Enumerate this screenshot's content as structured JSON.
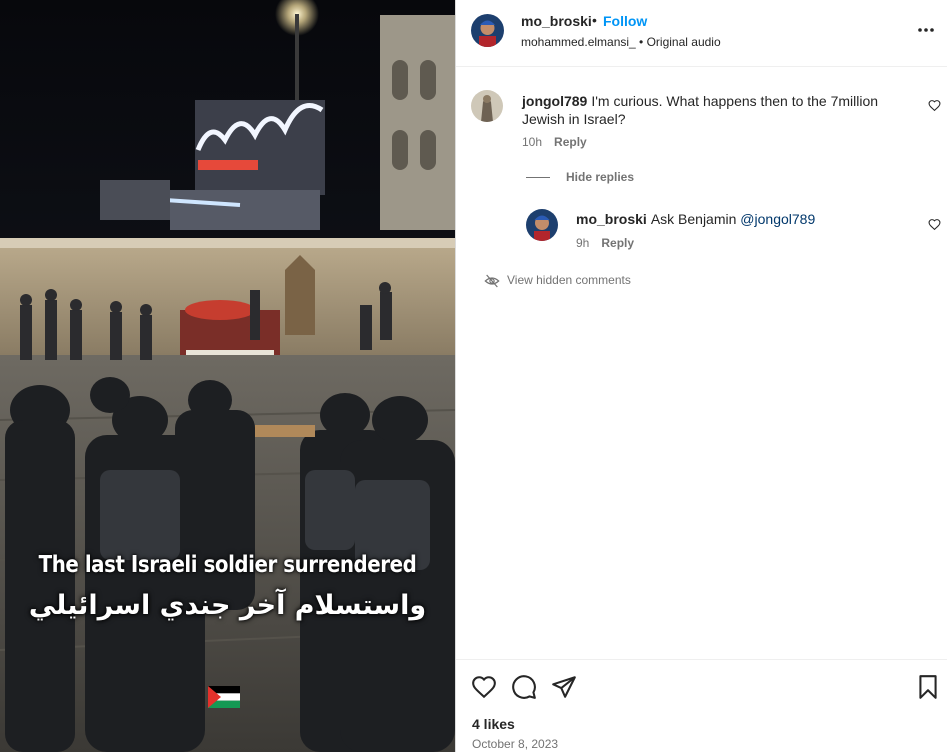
{
  "media": {
    "caption_en": "The last Israeli soldier surrendered",
    "caption_ar": "واستسلام آخر جندي اسرائيلي",
    "flag_icon": "palestine-flag-icon"
  },
  "header": {
    "username": "mo_broski",
    "separator": "•",
    "follow_label": "Follow",
    "audio_line": "mohammed.elmansi_ • Original audio",
    "more_icon": "more-options-icon"
  },
  "comments": [
    {
      "username": "jongol789",
      "text": "I'm curious. What happens then to the 7million Jewish in Israel?",
      "time": "10h",
      "reply_label": "Reply"
    }
  ],
  "replies_toggle": {
    "label": "Hide replies"
  },
  "replies": [
    {
      "username": "mo_broski",
      "text": "Ask Benjamin",
      "mention": "@jongol789",
      "time": "9h",
      "reply_label": "Reply"
    }
  ],
  "hidden_comments": {
    "label": "View hidden comments",
    "icon": "eye-off-icon"
  },
  "actions": {
    "like_icon": "heart-icon",
    "comment_icon": "comment-icon",
    "share_icon": "send-icon",
    "save_icon": "bookmark-icon"
  },
  "likes": "4 likes",
  "date": "October 8, 2023",
  "colors": {
    "follow": "#0095f6",
    "mention": "#00376b",
    "muted": "#737373",
    "text": "#262626"
  }
}
